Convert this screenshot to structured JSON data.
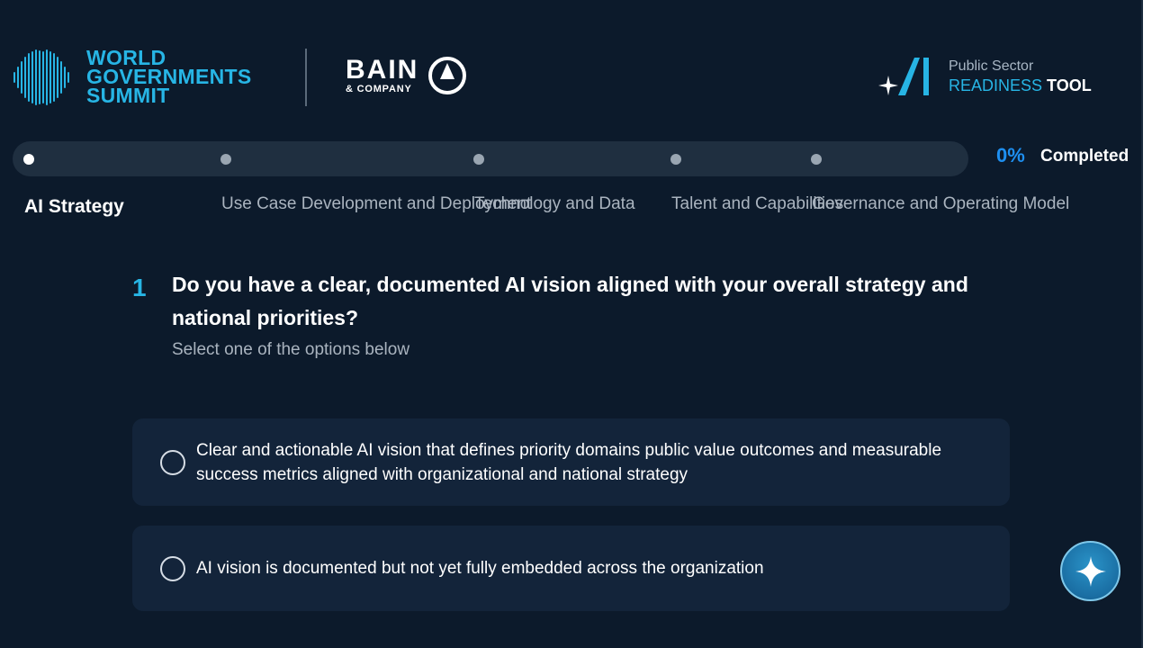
{
  "header": {
    "wgs_logo": {
      "line1": "WORLD",
      "line2": "GOVERNMENTS",
      "line3": "SUMMIT"
    },
    "bain_logo": {
      "main": "BAIN",
      "sub": "& COMPANY"
    },
    "tool_logo": {
      "line1": "Public Sector",
      "readiness": "READINESS",
      "tool": "TOOL"
    }
  },
  "progress": {
    "percent_label": "0%",
    "completed_label": "Completed",
    "value": 0
  },
  "steps": [
    {
      "label": "AI Strategy",
      "active": true
    },
    {
      "label": "Use Case Development and Deployment",
      "active": false
    },
    {
      "label": "Technology and Data",
      "active": false
    },
    {
      "label": "Talent and Capabilities",
      "active": false
    },
    {
      "label": "Governance and Operating Model",
      "active": false
    }
  ],
  "question": {
    "number": "1",
    "text": "Do you have a clear, documented AI vision aligned with your overall strategy and national priorities?",
    "hint": "Select one of the options below"
  },
  "options": [
    {
      "text": "Clear and actionable AI vision that defines priority domains public value outcomes and measurable success metrics aligned with organizational and national strategy",
      "selected": false
    },
    {
      "text": "AI vision is documented but not yet fully embedded across the organization",
      "selected": false
    }
  ],
  "colors": {
    "background": "#0c1a2b",
    "accent_cyan": "#27b5e5",
    "accent_blue": "#1e8ff0",
    "option_bg": "#13243a"
  },
  "icons": {
    "fab": "sparkle-icon",
    "wgs": "soundwave-icon",
    "bain": "compass-icon",
    "tool": "ai-star-icon"
  }
}
